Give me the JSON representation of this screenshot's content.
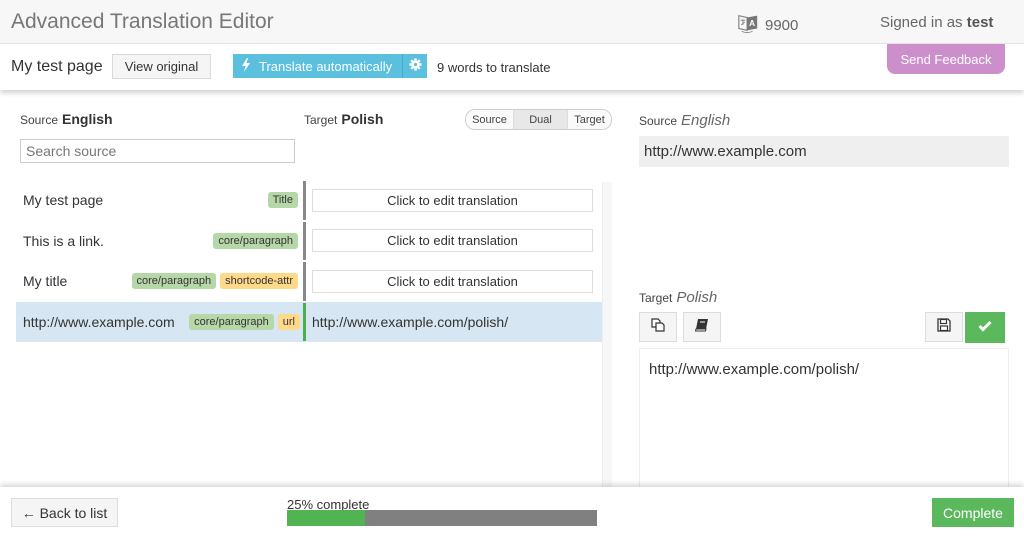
{
  "header": {
    "title": "Advanced Translation Editor",
    "credits_icon": "translate-icon",
    "credits": "9900",
    "signed_in_prefix": "Signed in as ",
    "username": "test"
  },
  "toolbar": {
    "page_name": "My test page",
    "view_original_label": "View original",
    "translate_auto_label": "Translate automatically",
    "translate_auto_icon": "bolt-icon",
    "settings_icon": "gear-icon",
    "words_to_translate": "9 words to translate",
    "send_feedback_label": "Send Feedback",
    "colors": {
      "translate": "#5bc0de",
      "feedback": "#cd8fcb"
    }
  },
  "list": {
    "source_label": "Source",
    "source_language": "English",
    "target_label": "Target",
    "target_language": "Polish",
    "search_placeholder": "Search source",
    "search_value": "",
    "view_modes": [
      "Source",
      "Dual",
      "Target"
    ],
    "active_view_mode": "Dual",
    "rows": [
      {
        "source": "My test page",
        "tags": [
          {
            "label": "Title",
            "color": "green"
          }
        ],
        "target": "Click to edit translation",
        "translated": false,
        "active": false
      },
      {
        "source": "This is a link.",
        "tags": [
          {
            "label": "core/paragraph",
            "color": "green"
          }
        ],
        "target": "Click to edit translation",
        "translated": false,
        "active": false
      },
      {
        "source": "My title",
        "tags": [
          {
            "label": "core/paragraph",
            "color": "green"
          },
          {
            "label": "shortcode-attr",
            "color": "yellow"
          }
        ],
        "target": "Click to edit translation",
        "translated": false,
        "active": false
      },
      {
        "source": "http://www.example.com",
        "tags": [
          {
            "label": "core/paragraph",
            "color": "green"
          },
          {
            "label": "url",
            "color": "yellow"
          }
        ],
        "target": "http://www.example.com/polish/",
        "translated": true,
        "active": true
      }
    ]
  },
  "editor": {
    "source_label": "Source",
    "source_language": "English",
    "source_text": "http://www.example.com",
    "target_label": "Target",
    "target_language": "Polish",
    "target_text": "http://www.example.com/polish/",
    "tools": [
      "copy-icon",
      "book-icon",
      "save-icon",
      "check-icon"
    ]
  },
  "footer": {
    "back_label": "← Back to list",
    "progress_label": "25% complete",
    "progress_percent": 25,
    "complete_label": "Complete"
  }
}
